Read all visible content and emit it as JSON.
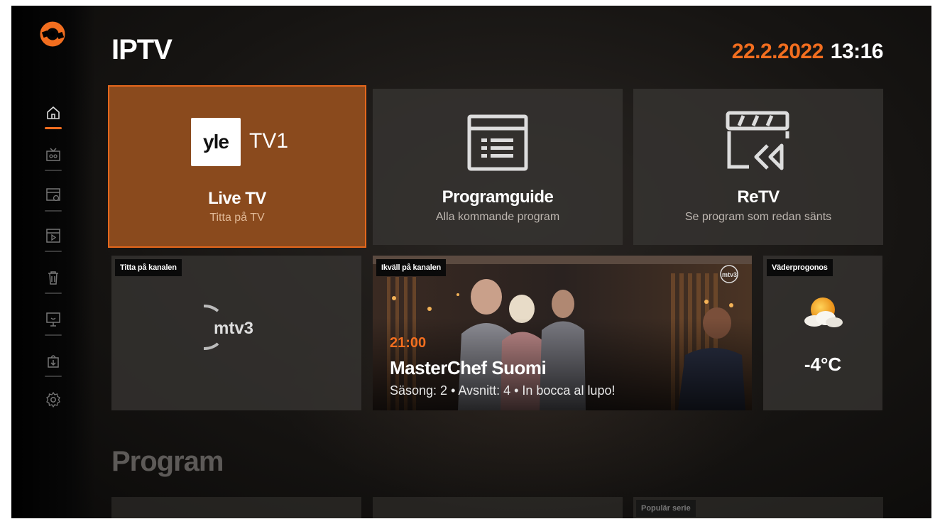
{
  "header": {
    "title": "IPTV",
    "date": "22.2.2022",
    "time": "13:16"
  },
  "sidebar": {
    "items": [
      {
        "icon": "home-icon",
        "active": true
      },
      {
        "icon": "tv-icon",
        "active": false
      },
      {
        "icon": "tv-schedule-icon",
        "active": false
      },
      {
        "icon": "video-library-icon",
        "active": false
      },
      {
        "icon": "trash-icon",
        "active": false
      },
      {
        "icon": "screen-icon",
        "active": false
      },
      {
        "icon": "download-icon",
        "active": false
      },
      {
        "icon": "settings-icon",
        "active": false
      }
    ]
  },
  "tiles": {
    "live": {
      "channel_logo": "yle",
      "channel_name": "TV1",
      "title": "Live TV",
      "subtitle": "Titta på TV"
    },
    "guide": {
      "title": "Programguide",
      "subtitle": "Alla kommande program"
    },
    "retv": {
      "title": "ReTV",
      "subtitle": "Se program som redan sänts"
    }
  },
  "channel_tile": {
    "tag": "Titta på kanalen",
    "logo": "mtv3"
  },
  "tonight": {
    "tag": "Ikväll på kanalen",
    "channel_logo": "mtv3",
    "time": "21:00",
    "title": "MasterChef Suomi",
    "meta": "Säsong: 2  •  Avsnitt: 4  •  In bocca al lupo!"
  },
  "weather": {
    "tag": "Väderprogonos",
    "icon": "partly-cloudy-icon",
    "temperature": "-4°C"
  },
  "section": {
    "title": "Program"
  },
  "row2": {
    "tag": "Populär serie"
  },
  "colors": {
    "accent": "#f26e1f",
    "active_tile": "#8a4a1d"
  }
}
